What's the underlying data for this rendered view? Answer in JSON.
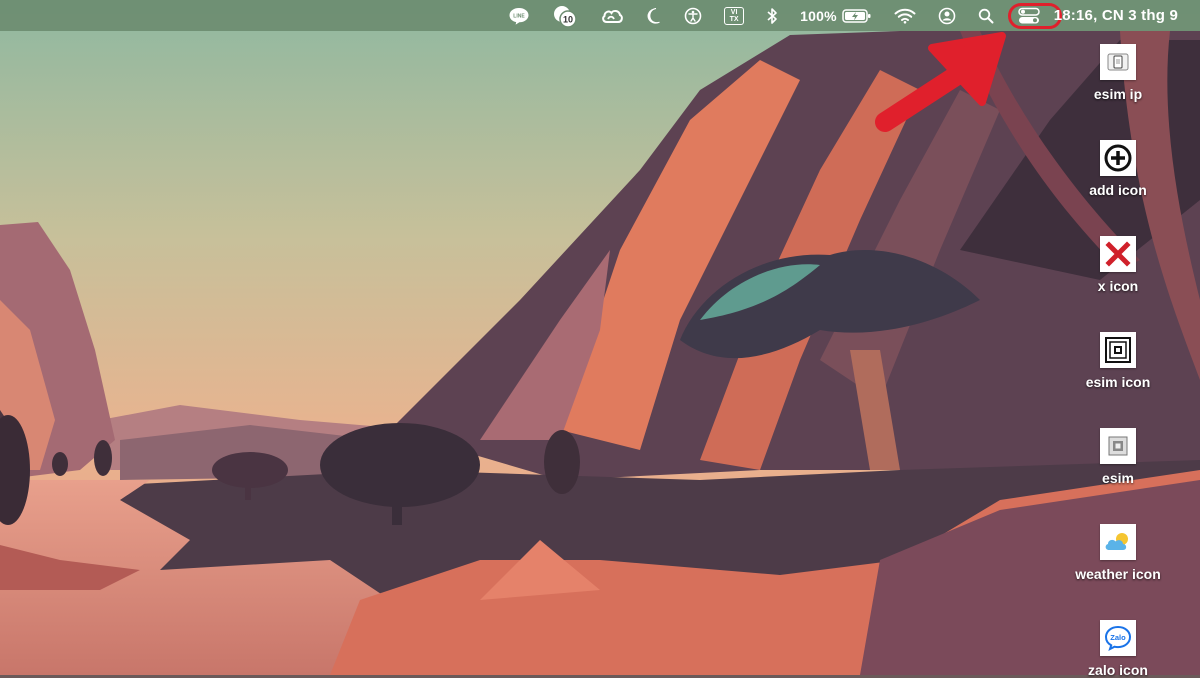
{
  "menubar": {
    "status_icons": [
      "line-icon",
      "notification-count-icon",
      "creative-cloud-icon",
      "moon-icon",
      "accessibility-icon",
      "vietnamese-input-icon",
      "bluetooth-icon",
      "battery-icon",
      "wifi-icon",
      "user-icon",
      "search-icon",
      "control-center-icon"
    ],
    "notification_count": "10",
    "line_label": "LINE",
    "input_method": {
      "line1": "VI",
      "line2": "TX"
    },
    "battery_percent": "100%",
    "clock": "18:16, CN 3 thg 9"
  },
  "annotation": {
    "highlight_color": "#e0202c",
    "highlighted_item": "control-center-icon"
  },
  "desktop_icons": [
    {
      "label": "esim ip",
      "icon": "phone-sim-icon"
    },
    {
      "label": "add icon",
      "icon": "plus-circle-icon"
    },
    {
      "label": "x icon",
      "icon": "red-x-icon"
    },
    {
      "label": "esim icon",
      "icon": "esim-chip-icon"
    },
    {
      "label": "esim",
      "icon": "esim-small-icon"
    },
    {
      "label": "weather icon",
      "icon": "cloud-sun-icon"
    },
    {
      "label": "zalo icon",
      "icon": "zalo-icon",
      "zalo_text": "Zalo"
    }
  ]
}
